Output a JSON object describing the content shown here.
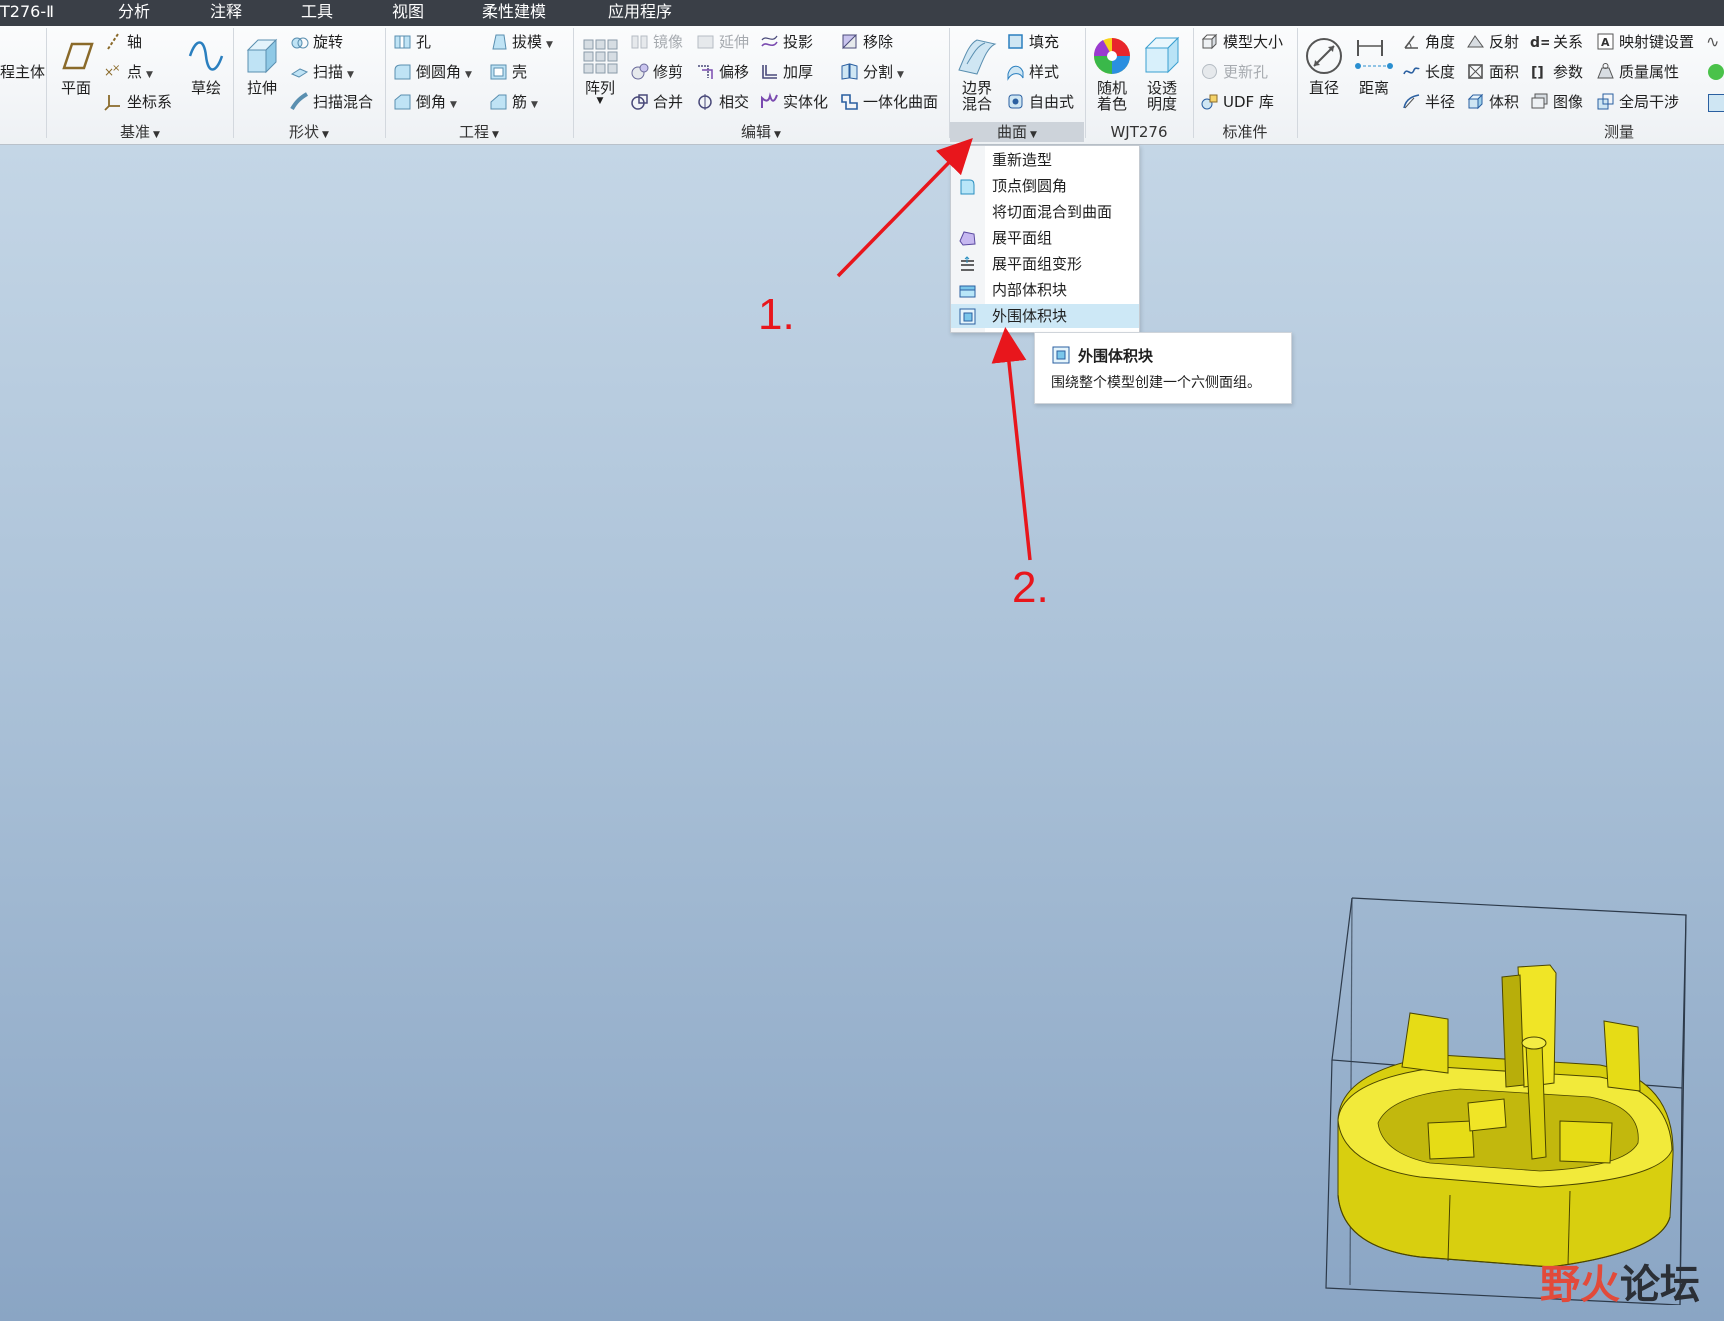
{
  "menu": [
    "T276-Ⅱ",
    "分析",
    "注释",
    "工具",
    "视图",
    "柔性建模",
    "应用程序"
  ],
  "ribbon": {
    "cut_left_label": "程主体",
    "datum": {
      "big_plane": "平面",
      "axis": "轴",
      "point": "点",
      "csys": "坐标系",
      "sketch": "草绘",
      "group": "基准"
    },
    "shapes": {
      "extrude": "拉伸",
      "revolve": "旋转",
      "sweep": "扫描",
      "swept_blend": "扫描混合",
      "group": "形状"
    },
    "engineering": {
      "hole": "孔",
      "round": "倒圆角",
      "chamfer": "倒角",
      "draft": "拔模",
      "shell": "壳",
      "rib": "筋",
      "group": "工程"
    },
    "editing": {
      "pattern": "阵列",
      "mirror": "镜像",
      "extend": "延伸",
      "project": "投影",
      "remove": "移除",
      "trim": "修剪",
      "offset": "偏移",
      "thicken": "加厚",
      "split": "分割",
      "merge": "合并",
      "intersect": "相交",
      "solidify": "实体化",
      "unify_surface": "一体化曲面",
      "group": "编辑"
    },
    "surfaces": {
      "boundary_blend": "边界混合",
      "fill": "填充",
      "style": "样式",
      "freestyle": "自由式",
      "group": "曲面"
    },
    "wjt": {
      "random_color": "随机着色",
      "set_transparency": "设透明度",
      "group": "WJT276"
    },
    "standard": {
      "model_size": "模型大小",
      "update_hole": "更新孔",
      "udf_lib": "UDF 库",
      "group": "标准件"
    },
    "measure": {
      "diameter": "直径",
      "distance": "距离",
      "angle": "角度",
      "length": "长度",
      "radius": "半径",
      "reflect": "反射",
      "area": "面积",
      "volume": "体积",
      "relations": "关系",
      "params": "参数",
      "image": "图像",
      "mapkey": "映射键设置",
      "mass_props": "质量属性",
      "global_interf": "全局干涉",
      "group": "测量"
    }
  },
  "dropdown_items": [
    "重新造型",
    "顶点倒圆角",
    "将切面混合到曲面",
    "展平面组",
    "展平面组变形",
    "内部体积块",
    "外围体积块"
  ],
  "highlighted_item": "外围体积块",
  "tooltip": {
    "title": "外围体积块",
    "desc": "围绕整个模型创建一个六侧面组。"
  },
  "annotations": {
    "step1": "1.",
    "step2": "2."
  },
  "watermark": {
    "part1": "野",
    "part2": "火",
    "part3": "论坛"
  },
  "colors": {
    "menu_bar": "#3a3f47",
    "annotation_red": "#e8161c",
    "model_yellow": "#e6dc16",
    "highlight": "#cde8f6"
  }
}
